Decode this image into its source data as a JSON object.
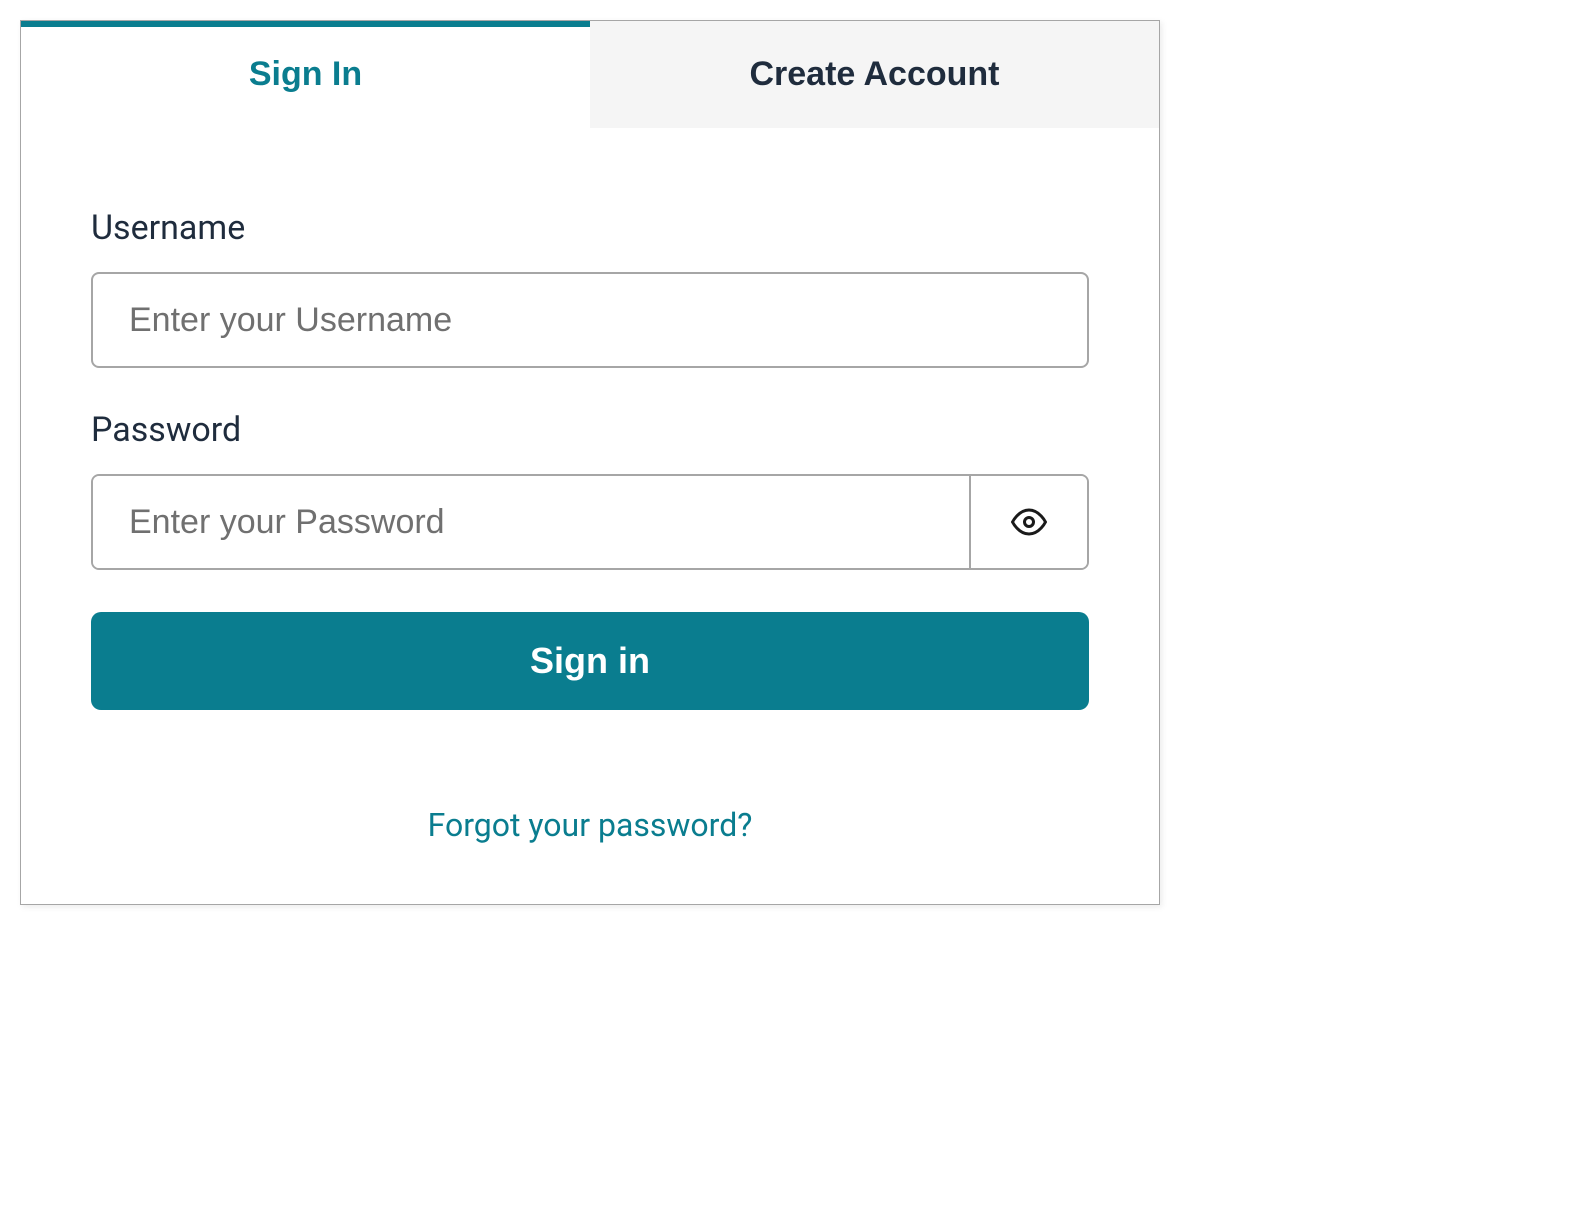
{
  "tabs": {
    "signin_label": "Sign In",
    "create_label": "Create Account"
  },
  "form": {
    "username_label": "Username",
    "username_placeholder": "Enter your Username",
    "password_label": "Password",
    "password_placeholder": "Enter your Password",
    "submit_label": "Sign in",
    "forgot_link": "Forgot your password?"
  },
  "icons": {
    "eye": "eye-icon"
  },
  "colors": {
    "accent": "#0a7d8f",
    "text_dark": "#1f2c3d",
    "border": "#a6a6a6",
    "tab_inactive_bg": "#f5f5f5"
  }
}
